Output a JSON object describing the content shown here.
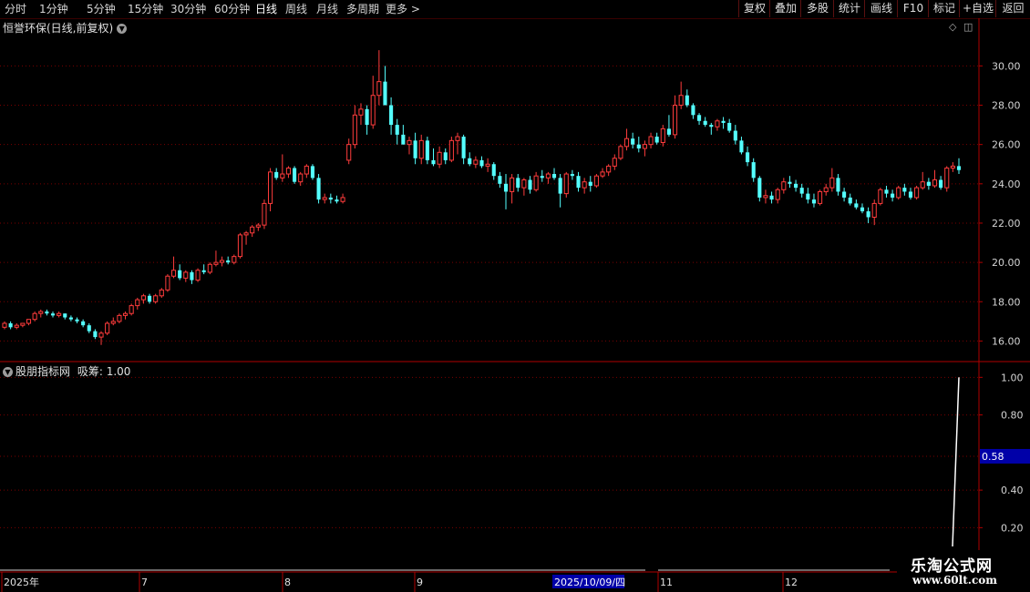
{
  "toolbar": {
    "periods": [
      "分时",
      "1分钟",
      "5分钟",
      "15分钟",
      "30分钟",
      "60分钟",
      "日线",
      "周线",
      "月线",
      "多周期",
      "更多 >"
    ],
    "active_period": "日线",
    "right_buttons": [
      "复权",
      "叠加",
      "多股",
      "统计",
      "画线",
      "F10",
      "标记",
      "+自选",
      "返回"
    ]
  },
  "main": {
    "title": "恒誉环保(日线,前复权)",
    "y_ticks": [
      "30.00",
      "28.00",
      "26.00",
      "24.00",
      "22.00",
      "20.00",
      "18.00",
      "16.00"
    ]
  },
  "indicator": {
    "title": "股朋指标网",
    "label": "吸筹: 1.00",
    "y_ticks": [
      "1.00",
      "0.80",
      "0.40",
      "0.20"
    ],
    "cursor_value": "0.58"
  },
  "x_axis": {
    "labels": [
      "2025年",
      "7",
      "8",
      "9",
      "11",
      "12"
    ],
    "cursor_date": "2025/10/09/四"
  },
  "watermark": {
    "line1": "乐淘公式网",
    "line2": "www.60lt.com"
  },
  "colors": {
    "up": "#ff3c3c",
    "down": "#54ffff",
    "grid": "#7a0000",
    "axis": "#b00000"
  },
  "chart_data": {
    "type": "candlestick",
    "ylim": [
      15.0,
      31.5
    ],
    "indicator_ylim": [
      0.1,
      1.05
    ],
    "candles": [
      [
        16.7,
        17.0,
        16.6,
        16.9
      ],
      [
        16.9,
        17.0,
        16.6,
        16.7
      ],
      [
        16.7,
        16.9,
        16.6,
        16.8
      ],
      [
        16.8,
        16.9,
        16.7,
        16.9
      ],
      [
        16.9,
        17.1,
        16.8,
        17.1
      ],
      [
        17.1,
        17.5,
        17.0,
        17.4
      ],
      [
        17.4,
        17.6,
        17.2,
        17.5
      ],
      [
        17.5,
        17.6,
        17.3,
        17.4
      ],
      [
        17.4,
        17.5,
        17.2,
        17.3
      ],
      [
        17.3,
        17.5,
        17.2,
        17.4
      ],
      [
        17.4,
        17.4,
        17.1,
        17.2
      ],
      [
        17.2,
        17.3,
        17.0,
        17.1
      ],
      [
        17.1,
        17.2,
        16.9,
        17.0
      ],
      [
        17.0,
        17.1,
        16.7,
        16.8
      ],
      [
        16.8,
        16.9,
        16.4,
        16.5
      ],
      [
        16.5,
        16.6,
        16.1,
        16.2
      ],
      [
        16.2,
        16.5,
        15.8,
        16.4
      ],
      [
        16.4,
        17.0,
        16.3,
        16.9
      ],
      [
        16.9,
        17.2,
        16.8,
        17.0
      ],
      [
        17.0,
        17.4,
        16.9,
        17.3
      ],
      [
        17.3,
        17.5,
        17.1,
        17.4
      ],
      [
        17.4,
        17.9,
        17.3,
        17.8
      ],
      [
        17.8,
        18.2,
        17.6,
        18.1
      ],
      [
        18.1,
        18.4,
        17.9,
        18.3
      ],
      [
        18.3,
        18.4,
        17.9,
        18.0
      ],
      [
        18.0,
        18.4,
        17.9,
        18.3
      ],
      [
        18.3,
        18.7,
        18.2,
        18.6
      ],
      [
        18.6,
        19.4,
        18.5,
        19.3
      ],
      [
        19.3,
        20.3,
        19.2,
        19.6
      ],
      [
        19.6,
        19.9,
        19.1,
        19.2
      ],
      [
        19.2,
        19.6,
        19.0,
        19.5
      ],
      [
        19.5,
        19.6,
        18.9,
        19.1
      ],
      [
        19.1,
        19.7,
        19.0,
        19.6
      ],
      [
        19.6,
        19.9,
        19.4,
        19.5
      ],
      [
        19.5,
        20.0,
        19.4,
        19.9
      ],
      [
        19.9,
        20.6,
        19.8,
        20.0
      ],
      [
        20.0,
        20.3,
        19.8,
        20.1
      ],
      [
        20.1,
        20.3,
        19.9,
        20.0
      ],
      [
        20.0,
        20.4,
        19.9,
        20.3
      ],
      [
        20.3,
        21.5,
        20.2,
        21.4
      ],
      [
        21.4,
        21.6,
        20.9,
        21.5
      ],
      [
        21.5,
        21.9,
        21.3,
        21.8
      ],
      [
        21.8,
        22.0,
        21.6,
        21.9
      ],
      [
        21.9,
        23.2,
        21.7,
        23.0
      ],
      [
        23.0,
        24.8,
        22.6,
        24.6
      ],
      [
        24.6,
        24.8,
        24.2,
        24.3
      ],
      [
        24.3,
        25.5,
        24.1,
        24.5
      ],
      [
        24.5,
        24.9,
        24.3,
        24.8
      ],
      [
        24.8,
        24.9,
        24.0,
        24.1
      ],
      [
        24.1,
        24.6,
        23.9,
        24.5
      ],
      [
        24.5,
        25.0,
        24.3,
        24.9
      ],
      [
        24.9,
        25.0,
        24.2,
        24.3
      ],
      [
        24.3,
        24.5,
        23.0,
        23.2
      ],
      [
        23.2,
        23.5,
        23.0,
        23.3
      ],
      [
        23.3,
        23.5,
        23.0,
        23.2
      ],
      [
        23.2,
        23.4,
        23.0,
        23.1
      ],
      [
        23.1,
        23.5,
        23.0,
        23.3
      ],
      [
        25.2,
        26.3,
        25.0,
        26.0
      ],
      [
        26.0,
        28.0,
        25.8,
        27.5
      ],
      [
        27.5,
        28.1,
        27.0,
        27.8
      ],
      [
        27.8,
        28.0,
        26.5,
        27.0
      ],
      [
        27.0,
        29.5,
        26.8,
        28.5
      ],
      [
        28.5,
        30.8,
        28.0,
        29.2
      ],
      [
        29.2,
        30.0,
        28.0,
        28.0
      ],
      [
        28.0,
        28.4,
        26.5,
        27.0
      ],
      [
        27.0,
        27.3,
        26.0,
        26.5
      ],
      [
        26.5,
        27.0,
        26.0,
        26.0
      ],
      [
        26.0,
        26.4,
        25.5,
        26.2
      ],
      [
        26.2,
        26.6,
        25.0,
        25.3
      ],
      [
        25.3,
        26.5,
        25.0,
        26.2
      ],
      [
        26.2,
        26.4,
        25.0,
        25.2
      ],
      [
        25.2,
        25.8,
        24.9,
        25.0
      ],
      [
        25.0,
        25.9,
        24.8,
        25.6
      ],
      [
        25.6,
        25.8,
        25.0,
        25.2
      ],
      [
        25.2,
        26.4,
        25.1,
        26.2
      ],
      [
        26.2,
        26.6,
        25.5,
        26.4
      ],
      [
        26.4,
        26.5,
        25.0,
        25.3
      ],
      [
        25.3,
        25.6,
        24.9,
        25.0
      ],
      [
        25.0,
        25.4,
        24.8,
        25.2
      ],
      [
        25.2,
        25.4,
        24.8,
        24.9
      ],
      [
        24.9,
        25.3,
        24.6,
        25.0
      ],
      [
        25.0,
        25.1,
        24.2,
        24.4
      ],
      [
        24.4,
        24.6,
        23.8,
        24.0
      ],
      [
        24.0,
        24.5,
        22.7,
        23.6
      ],
      [
        23.6,
        24.5,
        23.0,
        24.3
      ],
      [
        24.3,
        24.5,
        23.6,
        23.8
      ],
      [
        23.8,
        24.3,
        23.4,
        24.2
      ],
      [
        24.2,
        24.4,
        23.5,
        23.7
      ],
      [
        23.7,
        24.6,
        23.6,
        24.4
      ],
      [
        24.4,
        24.7,
        24.1,
        24.3
      ],
      [
        24.3,
        24.6,
        24.0,
        24.5
      ],
      [
        24.5,
        24.8,
        24.2,
        24.3
      ],
      [
        24.3,
        24.5,
        22.8,
        23.5
      ],
      [
        23.5,
        24.6,
        23.3,
        24.5
      ],
      [
        24.5,
        24.7,
        24.2,
        24.4
      ],
      [
        24.4,
        24.6,
        23.6,
        23.8
      ],
      [
        23.8,
        24.3,
        23.5,
        24.1
      ],
      [
        24.1,
        24.4,
        23.6,
        23.9
      ],
      [
        23.9,
        24.5,
        23.8,
        24.4
      ],
      [
        24.4,
        24.8,
        24.3,
        24.6
      ],
      [
        24.6,
        25.0,
        24.4,
        24.9
      ],
      [
        24.9,
        25.5,
        24.7,
        25.3
      ],
      [
        25.3,
        26.0,
        25.2,
        25.9
      ],
      [
        25.9,
        26.8,
        25.7,
        26.3
      ],
      [
        26.3,
        26.6,
        25.8,
        26.0
      ],
      [
        26.0,
        26.4,
        25.6,
        25.8
      ],
      [
        25.8,
        26.2,
        25.4,
        26.0
      ],
      [
        26.0,
        26.6,
        25.8,
        26.4
      ],
      [
        26.4,
        26.6,
        26.0,
        26.1
      ],
      [
        26.1,
        27.0,
        25.9,
        26.8
      ],
      [
        26.8,
        27.5,
        26.4,
        26.5
      ],
      [
        26.5,
        28.5,
        26.3,
        28.0
      ],
      [
        28.0,
        29.2,
        27.8,
        28.5
      ],
      [
        28.5,
        28.8,
        27.9,
        28.0
      ],
      [
        28.0,
        28.1,
        27.3,
        27.5
      ],
      [
        27.5,
        27.6,
        27.0,
        27.2
      ],
      [
        27.2,
        27.4,
        26.9,
        27.0
      ],
      [
        27.0,
        27.1,
        26.5,
        26.9
      ],
      [
        26.9,
        27.3,
        26.7,
        27.2
      ],
      [
        27.2,
        27.4,
        26.8,
        27.1
      ],
      [
        27.1,
        27.3,
        26.6,
        26.7
      ],
      [
        26.7,
        27.0,
        26.0,
        26.2
      ],
      [
        26.2,
        26.4,
        25.5,
        25.6
      ],
      [
        25.6,
        25.9,
        24.9,
        25.1
      ],
      [
        25.1,
        25.3,
        24.1,
        24.3
      ],
      [
        24.3,
        24.4,
        23.1,
        23.3
      ],
      [
        23.3,
        23.7,
        23.0,
        23.4
      ],
      [
        23.4,
        23.6,
        23.0,
        23.2
      ],
      [
        23.2,
        23.8,
        23.0,
        23.7
      ],
      [
        23.7,
        24.3,
        23.5,
        24.1
      ],
      [
        24.1,
        24.4,
        23.8,
        24.0
      ],
      [
        24.0,
        24.2,
        23.6,
        23.8
      ],
      [
        23.8,
        24.0,
        23.3,
        23.5
      ],
      [
        23.5,
        23.8,
        23.0,
        23.2
      ],
      [
        23.2,
        23.5,
        22.8,
        23.0
      ],
      [
        23.0,
        23.7,
        22.9,
        23.6
      ],
      [
        23.6,
        24.0,
        23.4,
        23.8
      ],
      [
        23.8,
        24.8,
        23.6,
        24.3
      ],
      [
        24.3,
        24.5,
        23.4,
        23.6
      ],
      [
        23.6,
        23.8,
        23.1,
        23.3
      ],
      [
        23.3,
        23.5,
        22.9,
        23.0
      ],
      [
        23.0,
        23.2,
        22.7,
        22.8
      ],
      [
        22.8,
        23.0,
        22.5,
        22.6
      ],
      [
        22.6,
        22.8,
        22.0,
        22.3
      ],
      [
        22.3,
        23.2,
        21.9,
        23.0
      ],
      [
        23.0,
        23.8,
        22.9,
        23.7
      ],
      [
        23.7,
        23.9,
        23.3,
        23.5
      ],
      [
        23.5,
        23.7,
        23.1,
        23.3
      ],
      [
        23.3,
        23.9,
        23.2,
        23.8
      ],
      [
        23.8,
        24.0,
        23.4,
        23.6
      ],
      [
        23.6,
        23.8,
        23.2,
        23.3
      ],
      [
        23.3,
        23.9,
        23.2,
        23.8
      ],
      [
        23.8,
        24.6,
        23.7,
        24.1
      ],
      [
        24.1,
        24.3,
        23.7,
        23.9
      ],
      [
        23.9,
        24.7,
        23.8,
        24.2
      ],
      [
        24.2,
        24.4,
        23.7,
        23.8
      ],
      [
        23.8,
        24.9,
        23.6,
        24.8
      ],
      [
        24.8,
        25.1,
        24.6,
        24.9
      ],
      [
        24.9,
        25.3,
        24.5,
        24.7
      ]
    ],
    "indicator_line": [
      [
        1045,
        0.1
      ],
      [
        1052,
        1.0
      ]
    ]
  }
}
